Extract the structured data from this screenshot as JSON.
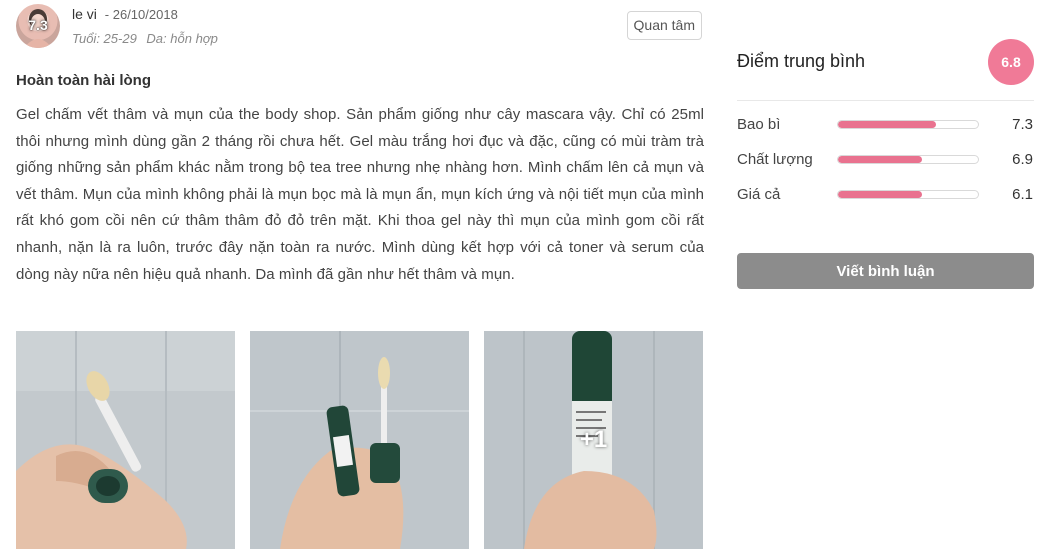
{
  "review": {
    "user": {
      "avatar_score": "7.3",
      "name": "le vi",
      "date": "- 26/10/2018",
      "age": "Tuổi: 25-29",
      "skin": "Da: hỗn hợp"
    },
    "follow_label": "Quan tâm",
    "title": "Hoàn toàn hài lòng",
    "body": "Gel chấm vết thâm và mụn của the body shop. Sản phẩm giống như cây mascara vậy. Chỉ có 25ml thôi nhưng mình dùng gần 2 tháng rồi chưa hết. Gel màu trắng hơi đục và đặc, cũng có mùi tràm trà giống những sản phẩm khác nằm trong bộ tea tree nhưng nhẹ nhàng hơn. Mình chấm lên cả mụn và vết thâm. Mụn của mình không phải là mụn bọc mà là mụn ẩn, mụn kích ứng và nội tiết mụn của mình rất khó gom cồi nên cứ thâm thâm đỏ đỏ trên mặt. Khi thoa gel này thì mụn của mình gom cồi rất nhanh, nặn là ra luôn, trước đây nặn toàn ra nước. Mình dùng kết hợp với cả toner và serum của dòng này nữa nên hiệu quả nhanh. Da mình đã gần như hết thâm và mụn.",
    "photos": [
      {
        "name": "photo-applicator-closeup"
      },
      {
        "name": "photo-open-tube"
      },
      {
        "name": "photo-tube-label",
        "more_label": "+1"
      }
    ]
  },
  "rating": {
    "title": "Điểm trung bình",
    "average": "6.8",
    "criteria": [
      {
        "label": "Bao bì",
        "value": "7.3",
        "fill_percent": 70
      },
      {
        "label": "Chất lượng",
        "value": "6.9",
        "fill_percent": 60
      },
      {
        "label": "Giá cả",
        "value": "6.1",
        "fill_percent": 60
      }
    ],
    "comment_button": "Viết bình luận"
  },
  "colors": {
    "accent_pink": "#f07a97",
    "bar_fill": "#e9728f",
    "button_gray": "#8c8c8c"
  }
}
